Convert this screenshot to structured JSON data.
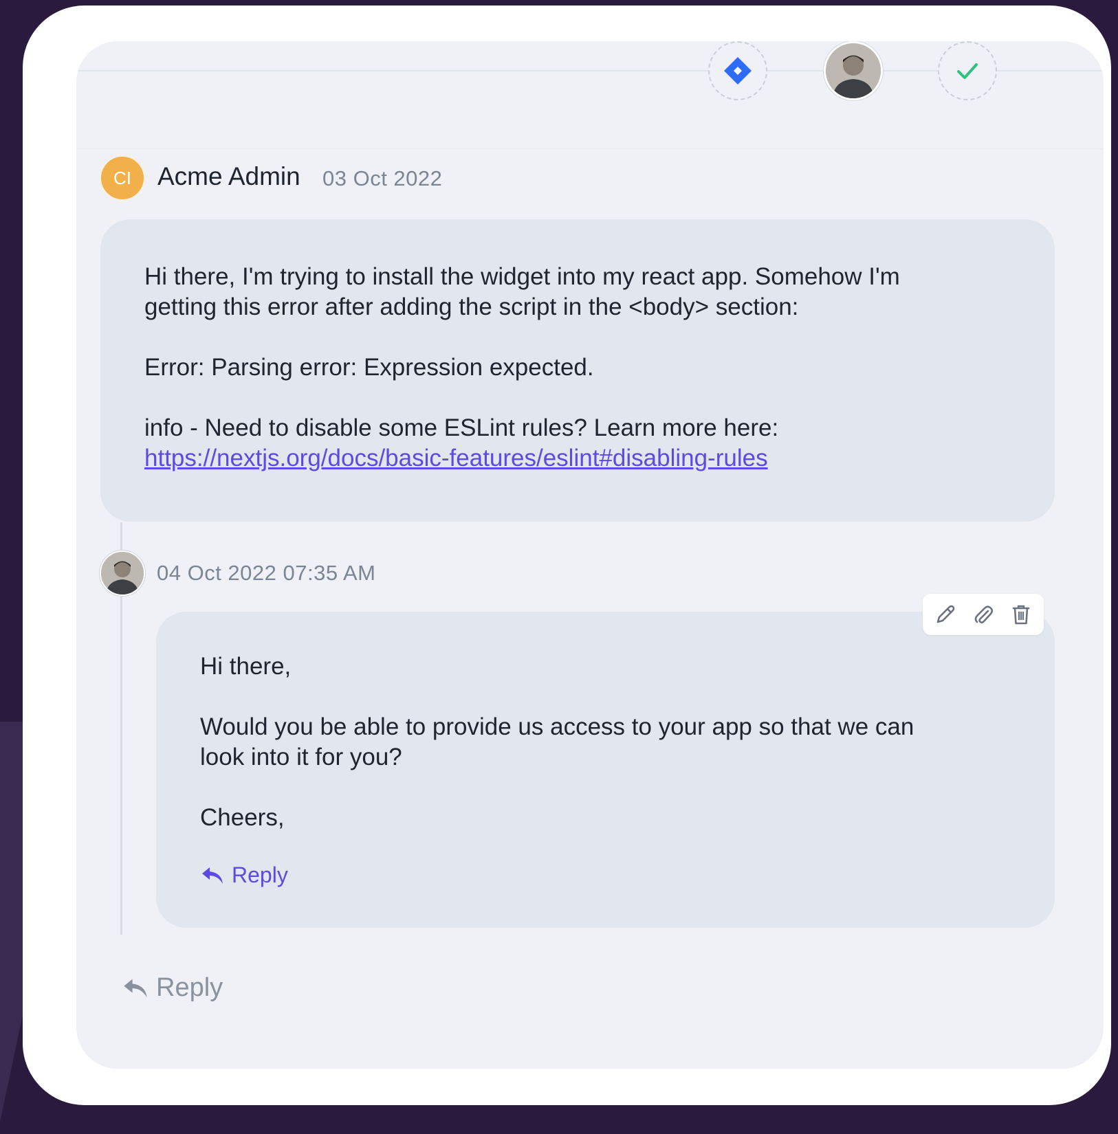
{
  "header": {
    "steps": [
      {
        "kind": "jira",
        "icon": "diamond-icon"
      },
      {
        "kind": "agent",
        "icon": "agent-avatar"
      },
      {
        "kind": "resolved",
        "icon": "check-icon"
      }
    ]
  },
  "message": {
    "avatar_initials": "CI",
    "author": "Acme Admin",
    "date": "03 Oct 2022",
    "line1": "Hi there, I'm trying to install the widget into my react app. Somehow I'm",
    "line2": "getting this error after adding the script in the <body> section:",
    "error": "Error: Parsing error: Expression expected.",
    "info": "info - Need to disable some ESLint rules? Learn more here:",
    "link": "https://nextjs.org/docs/basic-features/eslint#disabling-rules"
  },
  "response": {
    "timestamp": "04 Oct 2022 07:35 AM",
    "greeting": "Hi there,",
    "body_line1": "Would you be able to provide us access to your app so that we can",
    "body_line2": "look into it for you?",
    "signoff": "Cheers,",
    "reply_label": "Reply",
    "tools": [
      "pencil-icon",
      "paperclip-icon",
      "trash-icon"
    ]
  },
  "footer": {
    "reply_label": "Reply"
  },
  "colors": {
    "accent": "#5b4be0",
    "jira_blue": "#2f6cf6",
    "check_green": "#2ec27e",
    "initials_bg": "#f2b04a"
  }
}
